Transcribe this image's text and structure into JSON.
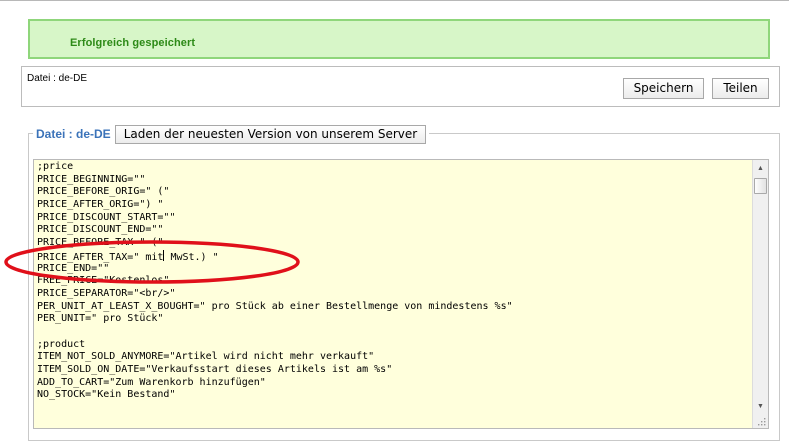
{
  "notice": {
    "message": "Erfolgreich gespeichert",
    "accent_color": "#2d8a17",
    "background_color": "#d7f6c8"
  },
  "file_header": {
    "label": "Datei : de-DE",
    "save_label": "Speichern",
    "share_label": "Teilen"
  },
  "section": {
    "title": "Datei : de-DE",
    "load_label": "Laden der neuesten Version von unserem Server"
  },
  "editor": {
    "lines": [
      ";price",
      "PRICE_BEGINNING=\"\"",
      "PRICE_BEFORE_ORIG=\" (\"",
      "PRICE_AFTER_ORIG=\") \"",
      "PRICE_DISCOUNT_START=\"\"",
      "PRICE_DISCOUNT_END=\"\"",
      "PRICE_BEFORE_TAX=\" (\"",
      "PRICE_AFTER_TAX=\" mit",
      "PRICE_END=\"\"",
      "FREE_PRICE=\"Kostenlos\"",
      "PRICE_SEPARATOR=\"<br/>\"",
      "PER_UNIT_AT_LEAST_X_BOUGHT=\" pro Stück ab einer Bestellmenge von mindestens %s\"",
      "PER_UNIT=\" pro Stück\"",
      "",
      ";product",
      "ITEM_NOT_SOLD_ANYMORE=\"Artikel wird nicht mehr verkauft\"",
      "ITEM_SOLD_ON_DATE=\"Verkaufsstart dieses Artikels ist am %s\"",
      "ADD_TO_CART=\"Zum Warenkorb hinzufügen\"",
      "NO_STOCK=\"Kein Bestand\""
    ],
    "cursor_line_tail": " MwSt.) \"",
    "highlight_color": "#e0101a",
    "scroll_up_icon": "▲",
    "scroll_down_icon": "▼"
  }
}
